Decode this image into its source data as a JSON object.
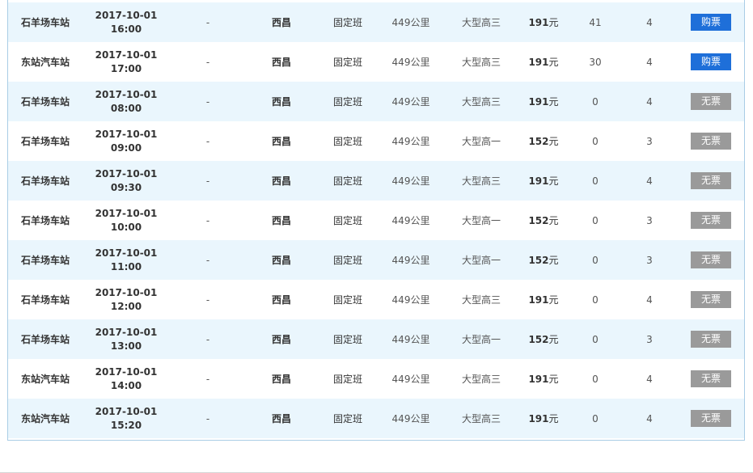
{
  "currency_suffix": "元",
  "rows": [
    {
      "station": "石羊场车站",
      "date": "2017-10-01",
      "time": "16:00",
      "via": "-",
      "destination": "西昌",
      "type": "固定班",
      "distance": "449公里",
      "bus": "大型高三",
      "price": "191",
      "remaining": "41",
      "child_tickets": "4",
      "action": "购票",
      "available": true
    },
    {
      "station": "东站汽车站",
      "date": "2017-10-01",
      "time": "17:00",
      "via": "-",
      "destination": "西昌",
      "type": "固定班",
      "distance": "449公里",
      "bus": "大型高三",
      "price": "191",
      "remaining": "30",
      "child_tickets": "4",
      "action": "购票",
      "available": true
    },
    {
      "station": "石羊场车站",
      "date": "2017-10-01",
      "time": "08:00",
      "via": "-",
      "destination": "西昌",
      "type": "固定班",
      "distance": "449公里",
      "bus": "大型高三",
      "price": "191",
      "remaining": "0",
      "child_tickets": "4",
      "action": "无票",
      "available": false
    },
    {
      "station": "石羊场车站",
      "date": "2017-10-01",
      "time": "09:00",
      "via": "-",
      "destination": "西昌",
      "type": "固定班",
      "distance": "449公里",
      "bus": "大型高一",
      "price": "152",
      "remaining": "0",
      "child_tickets": "3",
      "action": "无票",
      "available": false
    },
    {
      "station": "石羊场车站",
      "date": "2017-10-01",
      "time": "09:30",
      "via": "-",
      "destination": "西昌",
      "type": "固定班",
      "distance": "449公里",
      "bus": "大型高三",
      "price": "191",
      "remaining": "0",
      "child_tickets": "4",
      "action": "无票",
      "available": false
    },
    {
      "station": "石羊场车站",
      "date": "2017-10-01",
      "time": "10:00",
      "via": "-",
      "destination": "西昌",
      "type": "固定班",
      "distance": "449公里",
      "bus": "大型高一",
      "price": "152",
      "remaining": "0",
      "child_tickets": "3",
      "action": "无票",
      "available": false
    },
    {
      "station": "石羊场车站",
      "date": "2017-10-01",
      "time": "11:00",
      "via": "-",
      "destination": "西昌",
      "type": "固定班",
      "distance": "449公里",
      "bus": "大型高一",
      "price": "152",
      "remaining": "0",
      "child_tickets": "3",
      "action": "无票",
      "available": false
    },
    {
      "station": "石羊场车站",
      "date": "2017-10-01",
      "time": "12:00",
      "via": "-",
      "destination": "西昌",
      "type": "固定班",
      "distance": "449公里",
      "bus": "大型高三",
      "price": "191",
      "remaining": "0",
      "child_tickets": "4",
      "action": "无票",
      "available": false
    },
    {
      "station": "石羊场车站",
      "date": "2017-10-01",
      "time": "13:00",
      "via": "-",
      "destination": "西昌",
      "type": "固定班",
      "distance": "449公里",
      "bus": "大型高一",
      "price": "152",
      "remaining": "0",
      "child_tickets": "3",
      "action": "无票",
      "available": false
    },
    {
      "station": "东站汽车站",
      "date": "2017-10-01",
      "time": "14:00",
      "via": "-",
      "destination": "西昌",
      "type": "固定班",
      "distance": "449公里",
      "bus": "大型高三",
      "price": "191",
      "remaining": "0",
      "child_tickets": "4",
      "action": "无票",
      "available": false
    },
    {
      "station": "东站汽车站",
      "date": "2017-10-01",
      "time": "15:20",
      "via": "-",
      "destination": "西昌",
      "type": "固定班",
      "distance": "449公里",
      "bus": "大型高三",
      "price": "191",
      "remaining": "0",
      "child_tickets": "4",
      "action": "无票",
      "available": false
    }
  ]
}
